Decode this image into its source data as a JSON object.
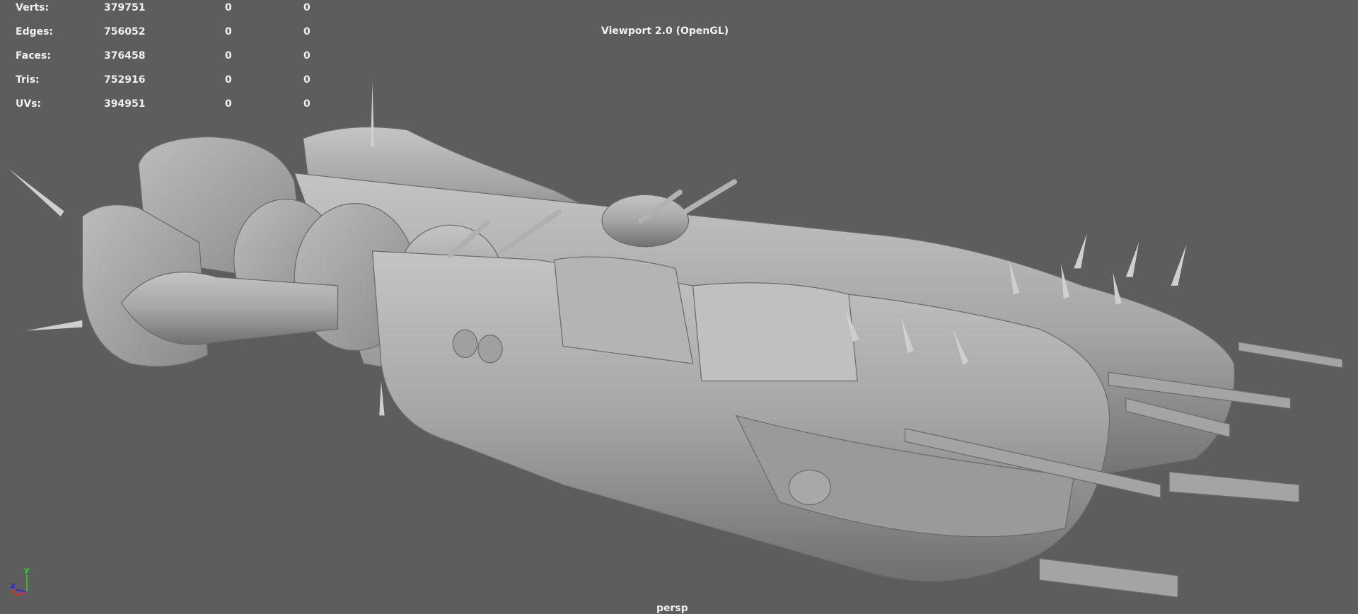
{
  "stats": [
    {
      "label": "Verts:",
      "total": "379751",
      "selected": "0",
      "uv": "0"
    },
    {
      "label": "Edges:",
      "total": "756052",
      "selected": "0",
      "uv": "0"
    },
    {
      "label": "Faces:",
      "total": "376458",
      "selected": "0",
      "uv": "0"
    },
    {
      "label": "Tris:",
      "total": "752916",
      "selected": "0",
      "uv": "0"
    },
    {
      "label": "UVs:",
      "total": "394951",
      "selected": "0",
      "uv": "0"
    }
  ],
  "renderer": "Viewport 2.0 (OpenGL)",
  "camera": "persp",
  "axis": {
    "x": "x",
    "y": "y",
    "z": "z",
    "x_color": "#ff2020",
    "y_color": "#20e020",
    "z_color": "#2020ff"
  },
  "colors": {
    "background": "#5d5d5d",
    "model": "#a8a8a8"
  }
}
